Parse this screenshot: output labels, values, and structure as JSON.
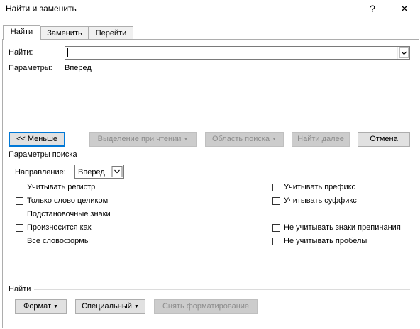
{
  "window": {
    "title": "Найти и заменить",
    "help_label": "?",
    "close_label": "✕"
  },
  "tabs": [
    {
      "label": "Найти",
      "active": true
    },
    {
      "label": "Заменить",
      "active": false
    },
    {
      "label": "Перейти",
      "active": false
    }
  ],
  "find": {
    "label": "Найти:",
    "value": "",
    "params_label": "Параметры:",
    "params_value": "Вперед"
  },
  "buttons": {
    "less": "<< Меньше",
    "reading_highlight": "Выделение при чтении",
    "search_in": "Область поиска",
    "find_next": "Найти далее",
    "cancel": "Отмена"
  },
  "search_options": {
    "section_label": "Параметры поиска",
    "direction_label": "Направление:",
    "direction_value": "Вперед",
    "left": [
      {
        "label": "Учитывать регистр",
        "checked": false
      },
      {
        "label": "Только слово целиком",
        "checked": false
      },
      {
        "label": "Подстановочные знаки",
        "checked": false
      },
      {
        "label": "Произносится как",
        "checked": false
      },
      {
        "label": "Все словоформы",
        "checked": false
      }
    ],
    "right": [
      {
        "label": "Учитывать префикс",
        "checked": false
      },
      {
        "label": "Учитывать суффикс",
        "checked": false
      },
      {
        "label": "Не учитывать знаки препинания",
        "checked": false
      },
      {
        "label": "Не учитывать пробелы",
        "checked": false
      }
    ]
  },
  "find_section": {
    "label": "Найти",
    "format": "Формат",
    "special": "Специальный",
    "no_formatting": "Снять форматирование"
  },
  "colors": {
    "focus": "#0078d7",
    "button": "#e1e1e1",
    "disabled_text": "#8d8d8d"
  }
}
